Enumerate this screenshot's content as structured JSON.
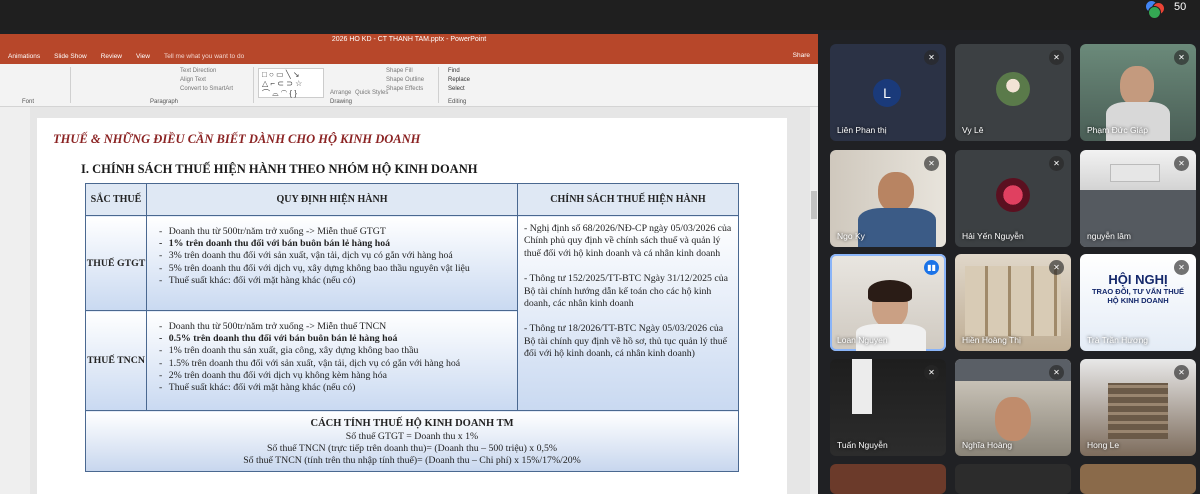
{
  "meeting": {
    "participant_count": "50"
  },
  "powerpoint": {
    "doc_title": "2026 HO KD - CT THANH TAM.pptx - PowerPoint",
    "tabs": [
      "Animations",
      "Slide Show",
      "Review",
      "View"
    ],
    "tell_me": "Tell me what you want to do",
    "share": "Share",
    "ribbon": {
      "text_direction": "Text Direction",
      "align_text": "Align Text",
      "convert_smartart": "Convert to SmartArt",
      "arrange": "Arrange",
      "quick_styles": "Quick Styles",
      "shape_fill": "Shape Fill",
      "shape_outline": "Shape Outline",
      "shape_effects": "Shape Effects",
      "find": "Find",
      "replace": "Replace",
      "select": "Select",
      "group_font": "Font",
      "group_paragraph": "Paragraph",
      "group_drawing": "Drawing",
      "group_editing": "Editing"
    }
  },
  "slide": {
    "title": "THUẾ & NHỮNG ĐIỀU CẦN BIẾT DÀNH CHO HỘ KINH DOANH",
    "section": "I. CHÍNH SÁCH THUẾ HIỆN HÀNH THEO NHÓM HỘ KINH DOANH",
    "headers": {
      "col1": "SẮC THUẾ",
      "col2": "QUY ĐỊNH HIỆN HÀNH",
      "col3": "CHÍNH SÁCH THUẾ HIỆN HÀNH"
    },
    "gtgt": {
      "label": "THUẾ GTGT",
      "items": [
        "Doanh thu từ 500tr/năm trở xuống -> Miễn thuế GTGT",
        "1% trên doanh thu đối với bán buôn bán lẻ hàng hoá",
        "3% trên doanh thu đối với sản xuất, vận tải, dịch vụ có gắn với hàng hoá",
        "5% trên doanh thu đối với dịch vụ, xây dựng không bao thầu nguyên vật liệu",
        "Thuế suất khác: đối với mặt hàng khác (nếu có)"
      ]
    },
    "tncn": {
      "label": "THUẾ TNCN",
      "items": [
        "Doanh thu từ 500tr/năm trở xuống -> Miễn thuế TNCN",
        "0.5% trên doanh thu đối với bán buôn bán lẻ hàng hoá",
        "1% trên doanh thu sản xuất, gia công, xây dựng không bao thầu",
        "1.5% trên doanh thu đối với sản xuất, vận tải, dịch vụ có gắn với hàng hoá",
        "2% trên doanh thu đối với dịch vụ không kèm hàng hóa",
        "Thuế suất khác: đối với mặt hàng khác (nếu có)"
      ]
    },
    "policies": [
      "Nghị định số 68/2026/NĐ-CP ngày 05/03/2026 của Chính phủ quy định về chính sách thuế và quản lý thuế đối với hộ kinh doanh và cá nhân kinh doanh",
      "Thông tư 152/2025/TT-BTC Ngày 31/12/2025 của Bộ tài chính hướng dẫn kế toán cho các hộ kinh doanh, các nhân kinh doanh",
      "Thông tư 18/2026/TT-BTC Ngày 05/03/2026 của Bộ tài chính quy định về hồ sơ, thủ tục quản lý thuế đối với hộ kinh doanh, cá nhân kinh doanh)"
    ],
    "formula": {
      "title": "CÁCH TÍNH THUẾ HỘ KINH DOANH TM",
      "lines": [
        "Số thuế GTGT = Doanh thu x 1%",
        "Số thuế TNCN (trực tiếp trên doanh thu)= (Doanh thu – 500 triệu) x 0,5%",
        "Số thuế TNCN (tính trên thu nhập tính thuế)= (Doanh thu – Chi phí) x 15%/17%/20%"
      ]
    }
  },
  "participants": [
    {
      "name": "Liên Phan thị",
      "avatar_letter": "L",
      "muted": true
    },
    {
      "name": "Vy Lê",
      "muted": true
    },
    {
      "name": "Phạm Đức Giáp",
      "muted": true
    },
    {
      "name": "Ngo Ky",
      "muted": true
    },
    {
      "name": "Hải Yến Nguyễn",
      "muted": true
    },
    {
      "name": "nguyễn lâm",
      "muted": true
    },
    {
      "name": "Loan Nguyen",
      "speaking": true
    },
    {
      "name": "Hiền Hoàng Thị",
      "muted": true
    },
    {
      "name": "Trà Trần Hương",
      "muted": true,
      "poster_title": "HỘI NGHỊ",
      "poster_subtitle": "TRAO ĐỔI, TƯ VẤN THUẾ HỘ KINH DOANH"
    },
    {
      "name": "Tuấn Nguyễn",
      "muted": true
    },
    {
      "name": "Nghĩa Hoàng",
      "muted": true
    },
    {
      "name": "Hong Le",
      "muted": true
    }
  ],
  "colors": {
    "accent_ppt": "#b7472a",
    "slide_title": "#8b2323",
    "table_border": "#4a6890",
    "meet_bg": "#202124",
    "speaking": "#8ab4f8"
  }
}
